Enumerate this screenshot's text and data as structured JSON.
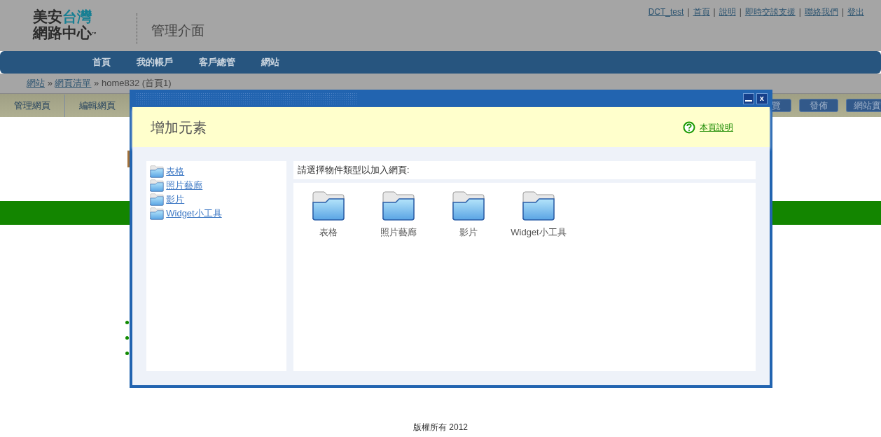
{
  "header": {
    "logo": {
      "line1": [
        {
          "text": "美安",
          "color": "#2b2b2b"
        },
        {
          "text": "台灣",
          "color": "#177f93"
        }
      ],
      "line2": "網路中心",
      "trademark": "™"
    },
    "title": "管理介面",
    "top_links": [
      {
        "kind": "link",
        "text": "DCT_test"
      },
      {
        "kind": "separator",
        "text": "|"
      },
      {
        "kind": "link",
        "text": "首頁"
      },
      {
        "kind": "separator",
        "text": "|"
      },
      {
        "kind": "link",
        "text": "說明"
      },
      {
        "kind": "separator",
        "text": "|"
      },
      {
        "kind": "link",
        "text": "即時交談支援"
      },
      {
        "kind": "separator",
        "text": "|"
      },
      {
        "kind": "link",
        "text": "聯絡我們"
      },
      {
        "kind": "separator",
        "text": "|"
      },
      {
        "kind": "link",
        "text": "登出"
      }
    ]
  },
  "main_nav": [
    "首頁",
    "我的帳戶",
    "客戶總管",
    "網站"
  ],
  "breadcrumb": [
    {
      "kind": "link",
      "text": "網站"
    },
    {
      "kind": "separator",
      "text": "»"
    },
    {
      "kind": "link",
      "text": "網頁清單"
    },
    {
      "kind": "separator",
      "text": "»"
    },
    {
      "kind": "current",
      "text": "home832 (首頁1)"
    }
  ],
  "toolbar": {
    "left": [
      "管理網頁",
      "編輯網頁"
    ],
    "right": [
      "覽",
      "發佈",
      "網站實"
    ]
  },
  "footer": "版權所有 2012",
  "dialog": {
    "heading": "增加元素",
    "help_link": "本頁說明",
    "close": "x",
    "tree": [
      "表格",
      "照片藝廊",
      "影片",
      "Widget小工具"
    ],
    "prompt": "請選擇物件類型以加入網頁:",
    "types": [
      "表格",
      "照片藝廊",
      "影片",
      "Widget小工具"
    ]
  }
}
